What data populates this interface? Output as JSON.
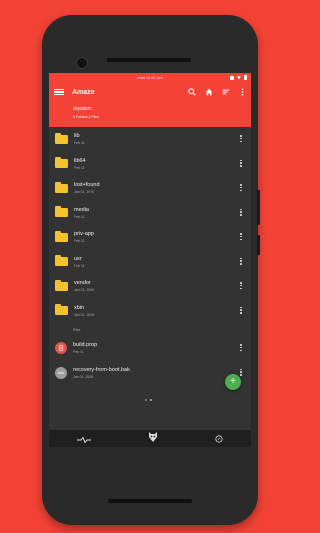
{
  "statusbar": {
    "time": "mon 11:47 pm"
  },
  "appbar": {
    "title": "Amaze"
  },
  "path": {
    "location": "/system",
    "summary": "9 Folders 2 Files"
  },
  "folders": [
    {
      "name": "lib",
      "date": "Feb 11"
    },
    {
      "name": "lib64",
      "date": "Feb 11"
    },
    {
      "name": "lost+found",
      "date": "Jan 01, 1970"
    },
    {
      "name": "media",
      "date": "Feb 11"
    },
    {
      "name": "priv-app",
      "date": "Feb 11"
    },
    {
      "name": "usr",
      "date": "Feb 11"
    },
    {
      "name": "vendor",
      "date": "Jan 01, 2009"
    },
    {
      "name": "xbin",
      "date": "Jan 01, 2009"
    }
  ],
  "files_label": "Files",
  "files": [
    {
      "name": "build.prop",
      "date": "Feb 11",
      "color": "#e05545",
      "icon": "document-icon"
    },
    {
      "name": "recovery-from-boot.bak",
      "date": "Jan 01, 2009",
      "color": "#9e9e9e",
      "icon": "bak-file-icon",
      "badge": "bak"
    }
  ],
  "fab": {
    "label": "+"
  },
  "colors": {
    "accent": "#f44336",
    "folder": "#f4c22b",
    "fab": "#4caf50",
    "background": "#333333"
  }
}
